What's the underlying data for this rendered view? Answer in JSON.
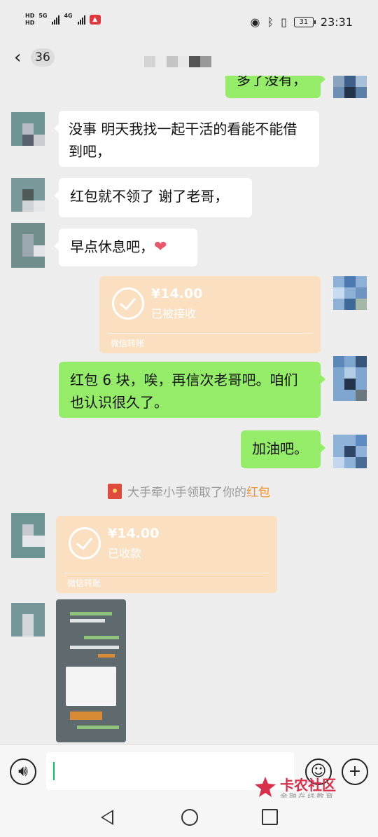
{
  "status_bar": {
    "hd1": "HD",
    "hd2": "HD",
    "net1": "5G",
    "net2": "4G",
    "battery": "31",
    "time": "23:31"
  },
  "nav": {
    "back_icon": "chevron-left-icon",
    "unread_count": "36"
  },
  "messages": {
    "m1_text": "多了没有，",
    "m2_text": "没事 明天我找一起干活的看能不能借到吧，",
    "m3_text": "红包就不领了 谢了老哥，",
    "m4_text": "早点休息吧，",
    "m4_emoji": "❤",
    "transfer1": {
      "amount": "¥14.00",
      "status": "已被接收",
      "source": "微信转账"
    },
    "m5_text": "红包 6 块，唉，再信次老哥吧。咱们也认识很久了。",
    "m6_text": "加油吧。",
    "sys_prefix": "大手牵小手领取了你的",
    "sys_link": "红包",
    "transfer2": {
      "amount": "¥14.00",
      "status": "已收款",
      "source": "微信转账"
    }
  },
  "input_bar": {
    "voice_icon": "voice-icon",
    "emoji_icon": "emoji-icon",
    "plus_icon": "plus-icon"
  },
  "watermark": {
    "title": "卡农社区",
    "subtitle": "金融在线教育"
  },
  "colors": {
    "background": "#ededed",
    "outgoing_bubble": "#95ec69",
    "incoming_bubble": "#ffffff",
    "transfer_card": "#fbdfc1",
    "red_packet_link": "#f3922c"
  }
}
